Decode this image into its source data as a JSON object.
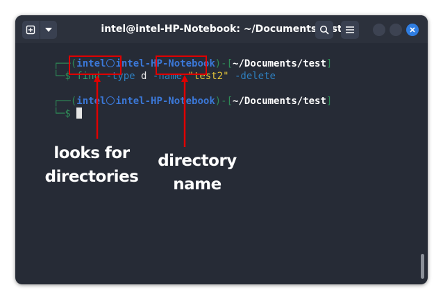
{
  "window": {
    "title": "intel@intel-HP-Notebook: ~/Documents/test"
  },
  "toolbar": {
    "new_tab_icon": "new-tab-icon",
    "menu_dropdown_icon": "chevron-down-icon",
    "search_icon": "search-icon",
    "hamburger_icon": "hamburger-menu-icon",
    "close_icon": "close-icon"
  },
  "terminal": {
    "prompt1": {
      "open": "┌──(",
      "user": "intel",
      "host": "intel-HP-Notebook",
      "sep": ")-[",
      "path": "~/Documents/test",
      "close": "]"
    },
    "command_line": {
      "prefix": "└─$ ",
      "cmd": "find",
      "opt_type": "-type",
      "arg_type": "d",
      "opt_name": "-name",
      "arg_name": "\"test2\"",
      "opt_delete": "-delete"
    },
    "prompt2": {
      "open": "┌──(",
      "user": "intel",
      "host": "intel-HP-Notebook",
      "sep": ")-[",
      "path": "~/Documents/test",
      "close": "]"
    },
    "prompt2_tail": "└─$ "
  },
  "annotations": {
    "left_line1": "looks for",
    "left_line2": "directories",
    "right_line1": "directory",
    "right_line2": "name"
  },
  "colors": {
    "terminal_bg": "#262b36",
    "highlight": "#e00000",
    "close_button": "#2f7de1"
  }
}
